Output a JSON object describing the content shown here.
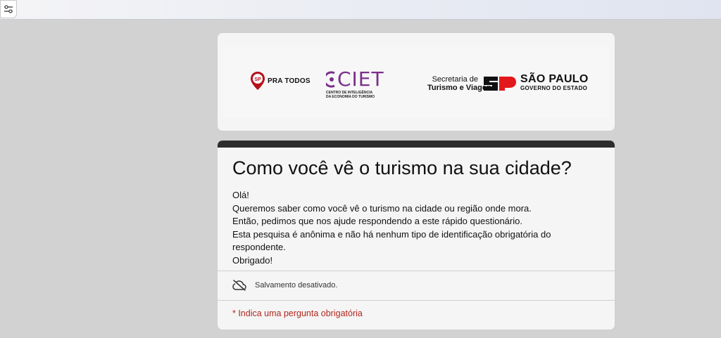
{
  "toolbar": {
    "tune_icon": "tune-icon"
  },
  "header": {
    "logos": {
      "sp_pra_todos": {
        "badge": "SP",
        "text": "PRA TODOS",
        "color": "#b5121b"
      },
      "ciet": {
        "text": "CIET",
        "subtitle_lines": [
          "CENTRO DE INTELIGÊNCIA",
          "DA ECONOMIA DO TURISMO"
        ],
        "color": "#7a2f8a"
      },
      "secretaria": {
        "line1": "Secretaria de",
        "line2": "Turismo e Viagens"
      },
      "sao_paulo": {
        "line1": "SÃO PAULO",
        "line2": "GOVERNO DO ESTADO",
        "mark_color": "#e3181b"
      }
    }
  },
  "form": {
    "title": "Como você vê o turismo na sua cidade?",
    "description": [
      "Olá!",
      "Queremos saber como você vê o turismo na cidade ou região onde mora.",
      "Então, pedimos que nos ajude respondendo a este rápido questionário.",
      "Esta pesquisa é anônima e não há nenhum tipo de identificação obrigatória do",
      "respondente.",
      "Obrigado!"
    ],
    "save_status": "Salvamento desativado.",
    "save_icon": "cloud-off-icon",
    "required_note": "* Indica uma pergunta obrigatória",
    "accent_color": "#2c2c2c",
    "required_color": "#b3261e"
  }
}
